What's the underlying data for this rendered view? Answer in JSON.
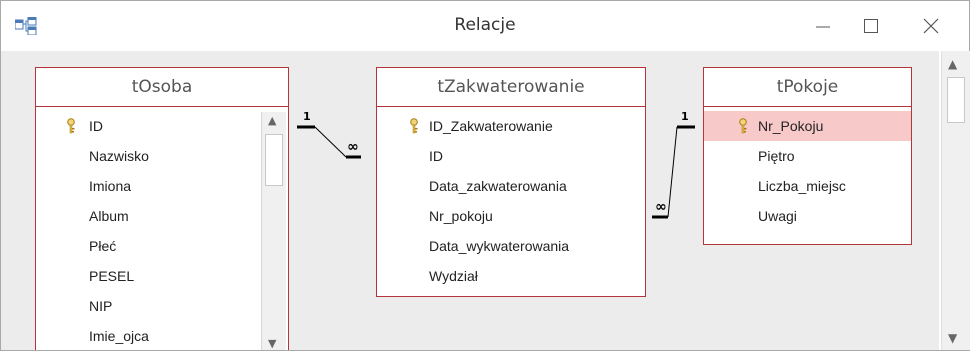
{
  "window": {
    "title": "Relacje"
  },
  "tables": {
    "osoba": {
      "name": "tOsoba",
      "fields": [
        "ID",
        "Nazwisko",
        "Imiona",
        "Album",
        "Płeć",
        "PESEL",
        "NIP",
        "Imie_ojca"
      ]
    },
    "zakw": {
      "name": "tZakwaterowanie",
      "fields": [
        "ID_Zakwaterowanie",
        "ID",
        "Data_zakwaterowania",
        "Nr_pokoju",
        "Data_wykwaterowania",
        "Wydział"
      ]
    },
    "pokoje": {
      "name": "tPokoje",
      "fields": [
        "Nr_Pokoju",
        "Piętro",
        "Liczba_miejsc",
        "Uwagi"
      ]
    }
  },
  "relationships": [
    {
      "one": "1",
      "many": "∞"
    },
    {
      "one": "1",
      "many": "∞"
    }
  ],
  "icons": {
    "app": "relationships-icon",
    "key": "primary-key-icon",
    "minimize": "minimize-icon",
    "maximize": "maximize-icon",
    "close": "close-icon"
  },
  "colors": {
    "table_border": "#b4343b",
    "selection": "#f8c9c9",
    "canvas": "#ececec"
  }
}
